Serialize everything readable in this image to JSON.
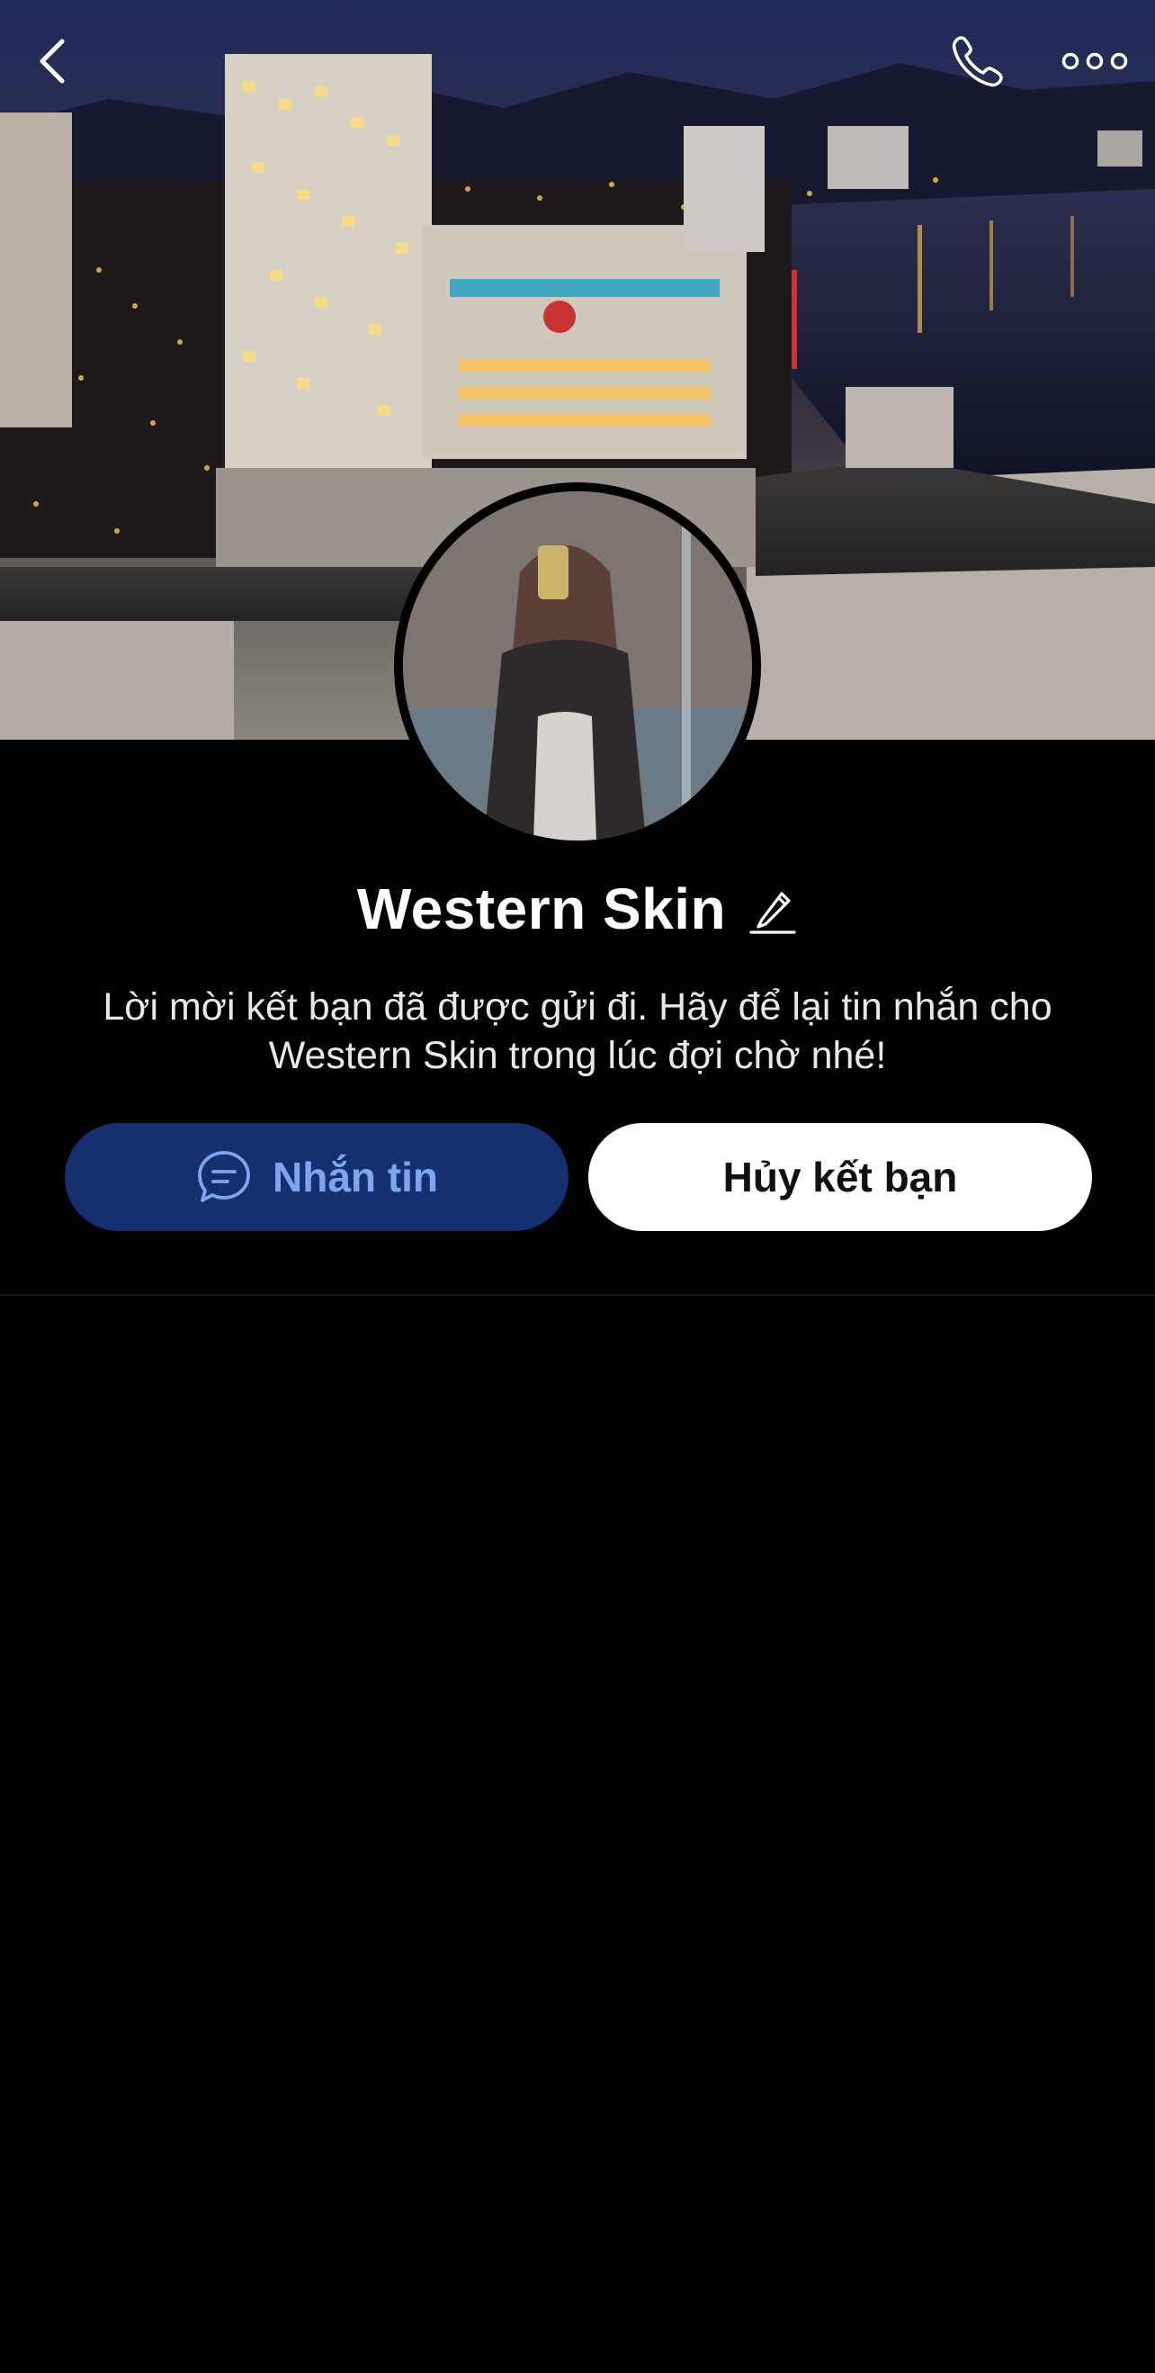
{
  "profile": {
    "name": "Western Skin",
    "description": "Lời mời kết bạn đã được gửi đi. Hãy để lại tin nhắn cho Western Skin trong lúc đợi chờ nhé!"
  },
  "actions": {
    "message_label": "Nhắn tin",
    "unfriend_label": "Hủy kết bạn"
  },
  "icons": {
    "back": "chevron-left-icon",
    "call": "phone-icon",
    "more": "more-horizontal-icon",
    "edit": "pencil-icon",
    "message": "chat-bubble-icon"
  },
  "colors": {
    "background": "#000000",
    "message_button_bg": "#14306e",
    "message_button_text": "#7ea6ee",
    "unfriend_button_bg": "#ffffff",
    "unfriend_button_text": "#111111"
  }
}
